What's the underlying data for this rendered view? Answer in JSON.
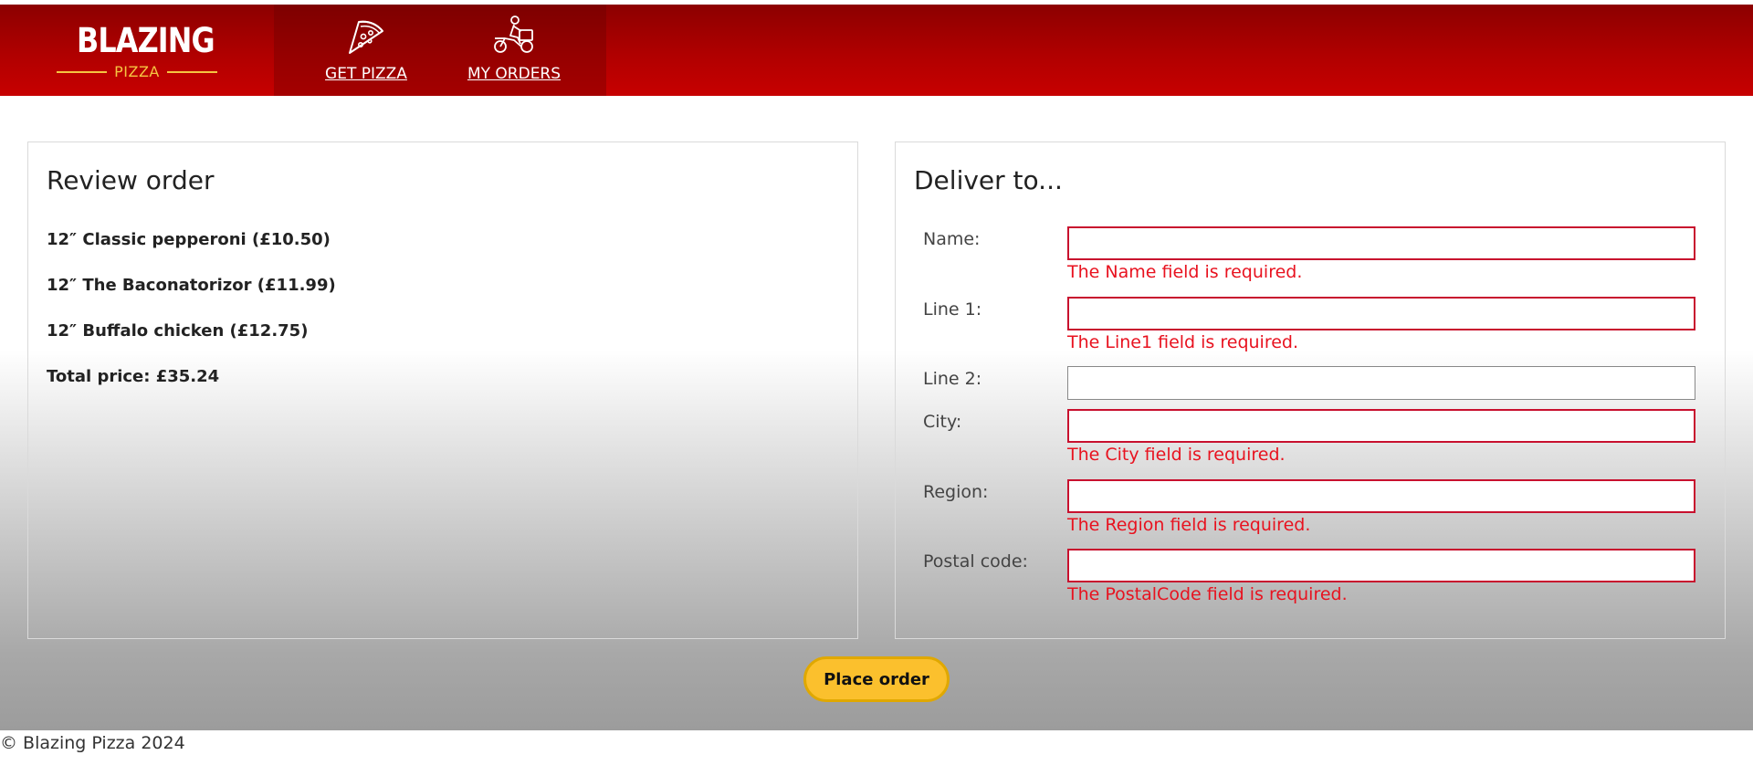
{
  "header": {
    "logo_title": "BLAZING",
    "logo_subtitle": "PIZZA",
    "nav": [
      {
        "label": "GET PIZZA",
        "icon": "pizza-slice-icon"
      },
      {
        "label": "MY ORDERS",
        "icon": "delivery-scooter-icon"
      }
    ]
  },
  "review": {
    "title": "Review order",
    "items": [
      "12″ Classic pepperoni (£10.50)",
      "12″ The Baconatorizor (£11.99)",
      "12″ Buffalo chicken (£12.75)"
    ],
    "total": "Total price: £35.24"
  },
  "deliver": {
    "title": "Deliver to...",
    "fields": [
      {
        "label": "Name:",
        "value": "",
        "error": "The Name field is required."
      },
      {
        "label": "Line 1:",
        "value": "",
        "error": "The Line1 field is required."
      },
      {
        "label": "Line 2:",
        "value": "",
        "error": ""
      },
      {
        "label": "City:",
        "value": "",
        "error": "The City field is required."
      },
      {
        "label": "Region:",
        "value": "",
        "error": "The Region field is required."
      },
      {
        "label": "Postal code:",
        "value": "",
        "error": "The PostalCode field is required."
      }
    ]
  },
  "actions": {
    "place_order": "Place order"
  },
  "footer": {
    "copyright": "© Blazing Pizza 2024"
  },
  "colors": {
    "brand_red": "#b00000",
    "button_yellow": "#fbc02d",
    "error_red": "#e8121f",
    "logo_gold": "#f5c542"
  }
}
